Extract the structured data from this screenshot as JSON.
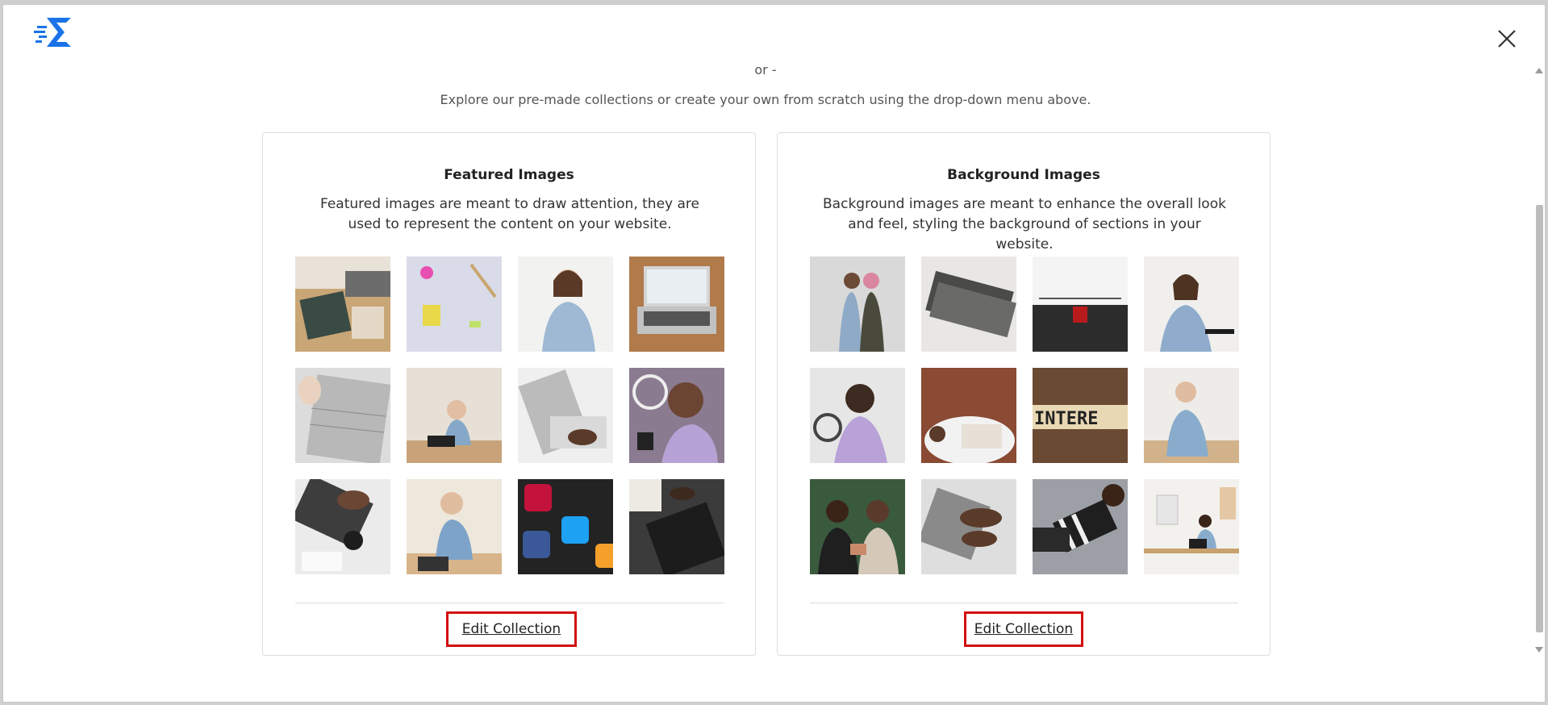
{
  "header": {
    "logo_icon": "kadence-logo-icon",
    "brand_color": "#1a73e8",
    "close_icon": "close-icon"
  },
  "main": {
    "or_text": "or -",
    "intro_text": "Explore our pre-made collections or create your own from scratch using the drop-down menu above."
  },
  "collections": [
    {
      "title": "Featured Images",
      "description": "Featured images are meant to draw attention, they are used to represent the content on your website.",
      "edit_label": "Edit Collection",
      "image_count": 12
    },
    {
      "title": "Background Images",
      "description": "Background images are meant to enhance the overall look and feel, styling the background of sections in your website.",
      "edit_label": "Edit Collection",
      "image_count": 12
    }
  ],
  "colors": {
    "highlight_border": "#d20f0f"
  }
}
